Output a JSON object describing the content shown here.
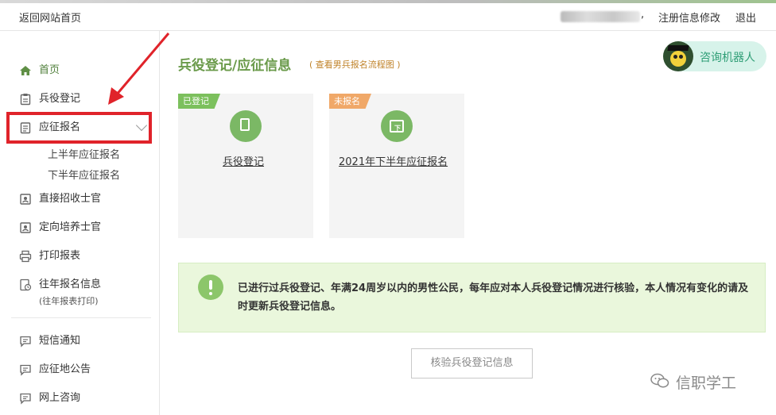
{
  "header": {
    "back_home": "返回网站首页",
    "separator": ",",
    "register_info_link": "注册信息修改",
    "logout": "退出"
  },
  "sidebar": {
    "items": [
      {
        "label": "首页",
        "icon": "home-icon"
      },
      {
        "label": "兵役登记",
        "icon": "clipboard-icon"
      },
      {
        "label": "应征报名",
        "icon": "form-icon"
      },
      {
        "label": "直接招收士官",
        "icon": "id-card-icon"
      },
      {
        "label": "定向培养士官",
        "icon": "id-card-icon"
      },
      {
        "label": "打印报表",
        "icon": "printer-icon"
      },
      {
        "label": "往年报名信息",
        "icon": "history-doc-icon"
      },
      {
        "label": "短信通知",
        "icon": "message-icon"
      },
      {
        "label": "应征地公告",
        "icon": "message-icon"
      },
      {
        "label": "网上咨询",
        "icon": "message-icon"
      }
    ],
    "sub_items": [
      "上半年应征报名",
      "下半年应征报名"
    ],
    "history_note": "(往年报表打印)"
  },
  "main": {
    "title": "兵役登记/应征信息",
    "flow_link": "( 查看男兵报名流程图 )",
    "robot": {
      "label": "咨询机器人"
    },
    "cards": [
      {
        "tag": "已登记",
        "link": "兵役登记"
      },
      {
        "tag": "未报名",
        "link": "2021年下半年应征报名"
      }
    ],
    "notice": "已进行过兵役登记、年满24周岁以内的男性公民，每年应对本人兵役登记情况进行核验，本人情况有变化的请及时更新兵役登记信息。",
    "verify_button": "核验兵役登记信息"
  },
  "watermark": {
    "text": "信职学工"
  },
  "colors": {
    "accent_green": "#6a9a4a",
    "tag_green": "#7cc05d",
    "tag_orange": "#f0a868",
    "notice_bg": "#eaf7dc",
    "annotation_red": "#e0232a"
  }
}
